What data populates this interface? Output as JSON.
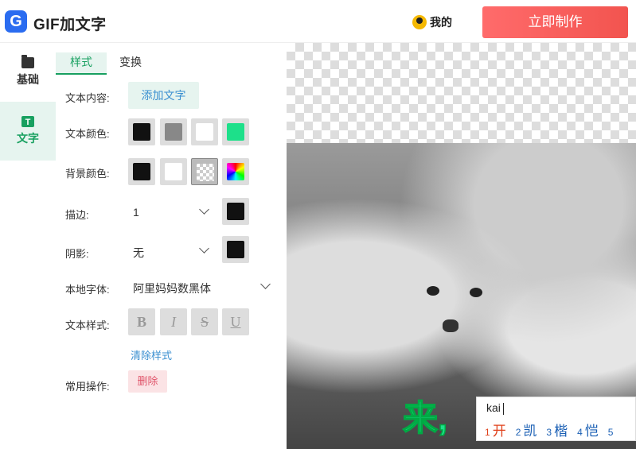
{
  "header": {
    "logo_letter": "G",
    "app_title": "GIF加文字",
    "user_label": "我的",
    "make_button": "立即制作"
  },
  "sidebar": {
    "items": [
      {
        "label": "基础",
        "icon": "folder-icon"
      },
      {
        "label": "文字",
        "icon": "text-icon",
        "icon_letter": "T",
        "active": true
      }
    ]
  },
  "panel": {
    "tabs": [
      {
        "label": "样式",
        "active": true
      },
      {
        "label": "变换"
      }
    ],
    "text_content_label": "文本内容:",
    "add_text_button": "添加文字",
    "text_color_label": "文本颜色:",
    "text_colors": [
      "#111111",
      "#888888",
      "#ffffff",
      "#1de08a"
    ],
    "bg_color_label": "背景颜色:",
    "bg_colors": [
      "#111111",
      "#ffffff",
      "transparent",
      "rainbow"
    ],
    "stroke_label": "描边:",
    "stroke_value": "1",
    "stroke_color": "#111111",
    "shadow_label": "阴影:",
    "shadow_value": "无",
    "shadow_color": "#111111",
    "font_label": "本地字体:",
    "font_value": "阿里妈妈数黑体",
    "text_style_label": "文本样式:",
    "style_buttons": [
      "B",
      "I",
      "S",
      "U"
    ],
    "clear_style_link": "清除样式",
    "actions_label": "常用操作:",
    "delete_button": "删除"
  },
  "canvas": {
    "caption_text": "来,"
  },
  "ime": {
    "input": "kai",
    "candidates": [
      {
        "n": "1",
        "text": "开"
      },
      {
        "n": "2",
        "text": "凯"
      },
      {
        "n": "3",
        "text": "楷"
      },
      {
        "n": "4",
        "text": "恺"
      },
      {
        "n": "5",
        "text": ""
      }
    ]
  },
  "colors": {
    "accent": "#18a060",
    "primary_button": "#f2544f",
    "link": "#3a8fd0"
  }
}
